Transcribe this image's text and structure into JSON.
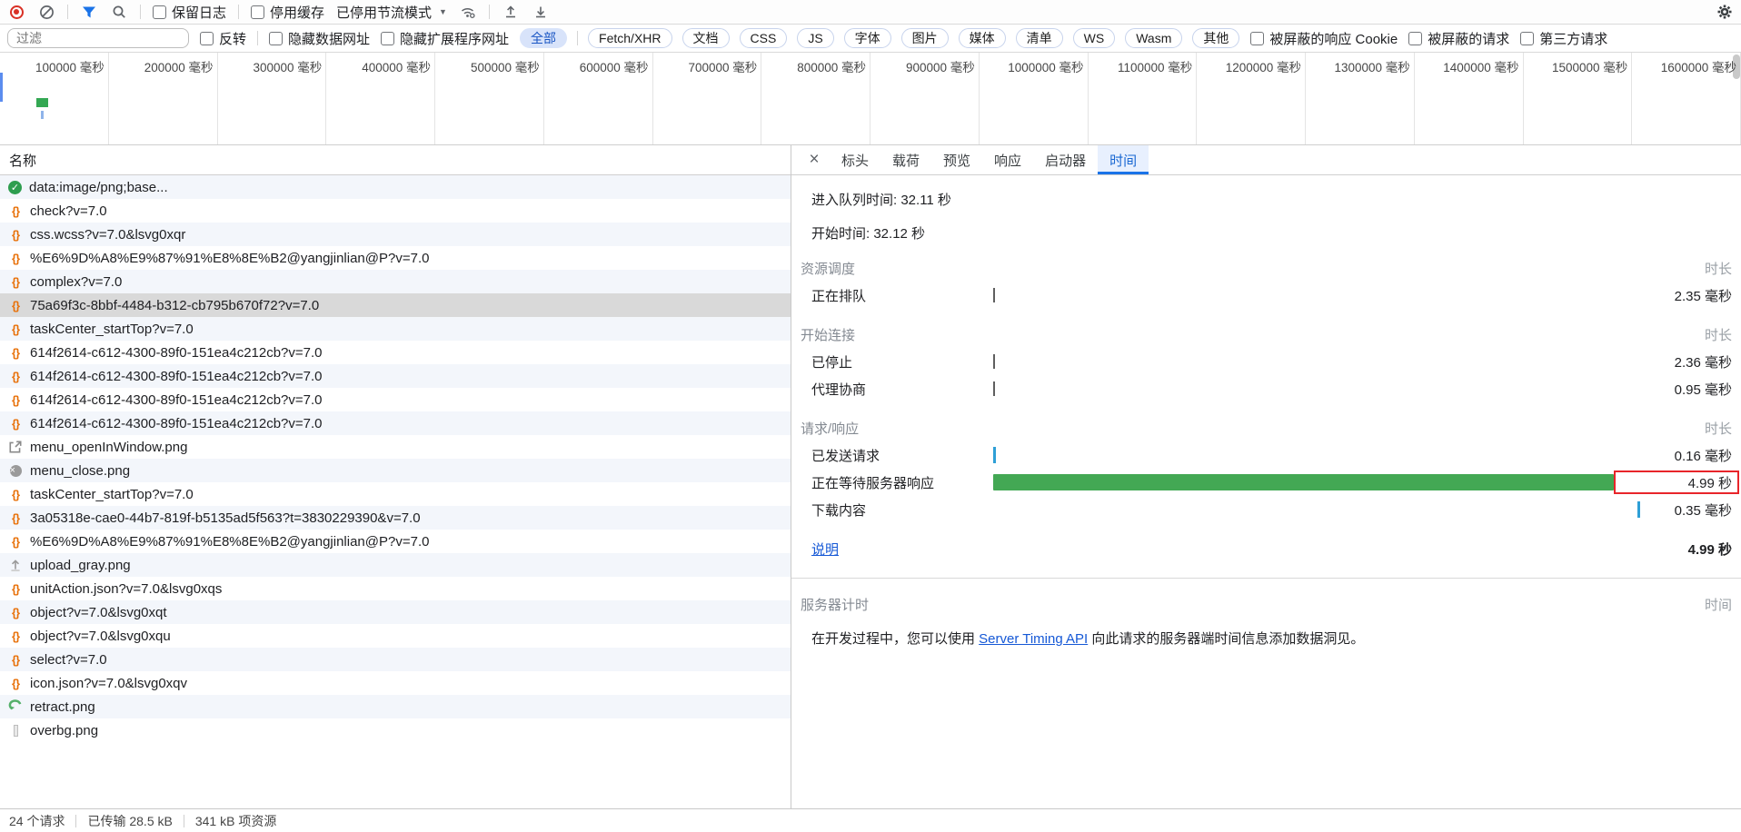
{
  "toolbar": {
    "preserve_log_label": "保留日志",
    "disable_cache_label": "停用缓存",
    "throttling_value": "已停用节流模式"
  },
  "filter_bar": {
    "placeholder": "过滤",
    "invert_label": "反转",
    "hide_data_urls_label": "隐藏数据网址",
    "hide_extension_urls_label": "隐藏扩展程序网址",
    "chips": [
      "全部",
      "Fetch/XHR",
      "文档",
      "CSS",
      "JS",
      "字体",
      "图片",
      "媒体",
      "清单",
      "WS",
      "Wasm",
      "其他"
    ],
    "selected_chip": "全部",
    "blocked_cookies_label": "被屏蔽的响应 Cookie",
    "blocked_requests_label": "被屏蔽的请求",
    "third_party_label": "第三方请求"
  },
  "overview": {
    "labels": [
      "100000 毫秒",
      "200000 毫秒",
      "300000 毫秒",
      "400000 毫秒",
      "500000 毫秒",
      "600000 毫秒",
      "700000 毫秒",
      "800000 毫秒",
      "900000 毫秒",
      "1000000 毫秒",
      "1100000 毫秒",
      "1200000 毫秒",
      "1300000 毫秒",
      "1400000 毫秒",
      "1500000 毫秒",
      "1600000 毫秒"
    ]
  },
  "requests": {
    "header": "名称",
    "rows": [
      {
        "name": "data:image/png;base...",
        "icon": "success"
      },
      {
        "name": "check?v=7.0",
        "icon": "script"
      },
      {
        "name": "css.wcss?v=7.0&lsvg0xqr",
        "icon": "script"
      },
      {
        "name": "%E6%9D%A8%E9%87%91%E8%8E%B2@yangjinlian@P?v=7.0",
        "icon": "script"
      },
      {
        "name": "complex?v=7.0",
        "icon": "script"
      },
      {
        "name": "75a69f3c-8bbf-4484-b312-cb795b670f72?v=7.0",
        "icon": "script",
        "selected": true
      },
      {
        "name": "taskCenter_startTop?v=7.0",
        "icon": "script"
      },
      {
        "name": "614f2614-c612-4300-89f0-151ea4c212cb?v=7.0",
        "icon": "script"
      },
      {
        "name": "614f2614-c612-4300-89f0-151ea4c212cb?v=7.0",
        "icon": "script"
      },
      {
        "name": "614f2614-c612-4300-89f0-151ea4c212cb?v=7.0",
        "icon": "script"
      },
      {
        "name": "614f2614-c612-4300-89f0-151ea4c212cb?v=7.0",
        "icon": "script"
      },
      {
        "name": "menu_openInWindow.png",
        "icon": "img-open"
      },
      {
        "name": "menu_close.png",
        "icon": "img-close"
      },
      {
        "name": "taskCenter_startTop?v=7.0",
        "icon": "script"
      },
      {
        "name": "3a05318e-cae0-44b7-819f-b5135ad5f563?t=3830229390&v=7.0",
        "icon": "script"
      },
      {
        "name": "%E6%9D%A8%E9%87%91%E8%8E%B2@yangjinlian@P?v=7.0",
        "icon": "script"
      },
      {
        "name": "upload_gray.png",
        "icon": "img-upload"
      },
      {
        "name": "unitAction.json?v=7.0&lsvg0xqs",
        "icon": "script"
      },
      {
        "name": "object?v=7.0&lsvg0xqt",
        "icon": "script"
      },
      {
        "name": "object?v=7.0&lsvg0xqu",
        "icon": "script"
      },
      {
        "name": "select?v=7.0",
        "icon": "script"
      },
      {
        "name": "icon.json?v=7.0&lsvg0xqv",
        "icon": "script"
      },
      {
        "name": "retract.png",
        "icon": "img-retract"
      },
      {
        "name": "overbg.png",
        "icon": "img-sliver"
      }
    ]
  },
  "details": {
    "tabs": [
      "标头",
      "载荷",
      "预览",
      "响应",
      "启动器",
      "时间"
    ],
    "active_tab": "时间",
    "queued_label": "进入队列时间:",
    "queued_value": "32.11 秒",
    "started_label": "开始时间:",
    "started_value": "32.12 秒",
    "timing": {
      "duration_header": "时长",
      "sections": [
        {
          "title": "资源调度",
          "rows": [
            {
              "label": "正在排队",
              "value": "2.35 毫秒",
              "marker": "tick-dark"
            }
          ]
        },
        {
          "title": "开始连接",
          "rows": [
            {
              "label": "已停止",
              "value": "2.36 毫秒",
              "marker": "tick-dark"
            },
            {
              "label": "代理协商",
              "value": "0.95 毫秒",
              "marker": "tick-dark"
            }
          ]
        },
        {
          "title": "请求/响应",
          "rows": [
            {
              "label": "已发送请求",
              "value": "0.16 毫秒",
              "marker": "tick-blue"
            },
            {
              "label": "正在等待服务器响应",
              "value": "4.99 秒",
              "marker": "bar-green",
              "highlighted": true
            },
            {
              "label": "下载内容",
              "value": "0.35 毫秒",
              "marker": "tick-blue-end"
            }
          ]
        }
      ],
      "footer_link": "说明",
      "total": "4.99 秒"
    },
    "server_timing": {
      "title": "服务器计时",
      "column_header": "时间",
      "text_before": "在开发过程中，您可以使用 ",
      "link": "Server Timing API",
      "text_after": " 向此请求的服务器端时间信息添加数据洞见。"
    }
  },
  "status_bar": {
    "requests_count": "24 个请求",
    "transferred": "已传输 28.5 kB",
    "resources": "341 kB 项资源"
  },
  "icons": {
    "record-icon": "●",
    "clear-icon": "⊘",
    "filter-icon": "funnel",
    "search-icon": "magnifier",
    "throttle-caret-icon": "▼",
    "network-conditions-icon": "signal-gear",
    "import-har-icon": "↥",
    "export-har-icon": "↧",
    "settings-gear-icon": "⚙",
    "close-icon": "×",
    "success-check-icon": "✓",
    "script-file-icon": "{}"
  },
  "colors": {
    "accent_blue": "#1a73e8",
    "waiting_green": "#43a854",
    "highlight_red": "#e8252a",
    "record_red": "#d93025",
    "selected_row_gray": "#d9d9d9"
  }
}
